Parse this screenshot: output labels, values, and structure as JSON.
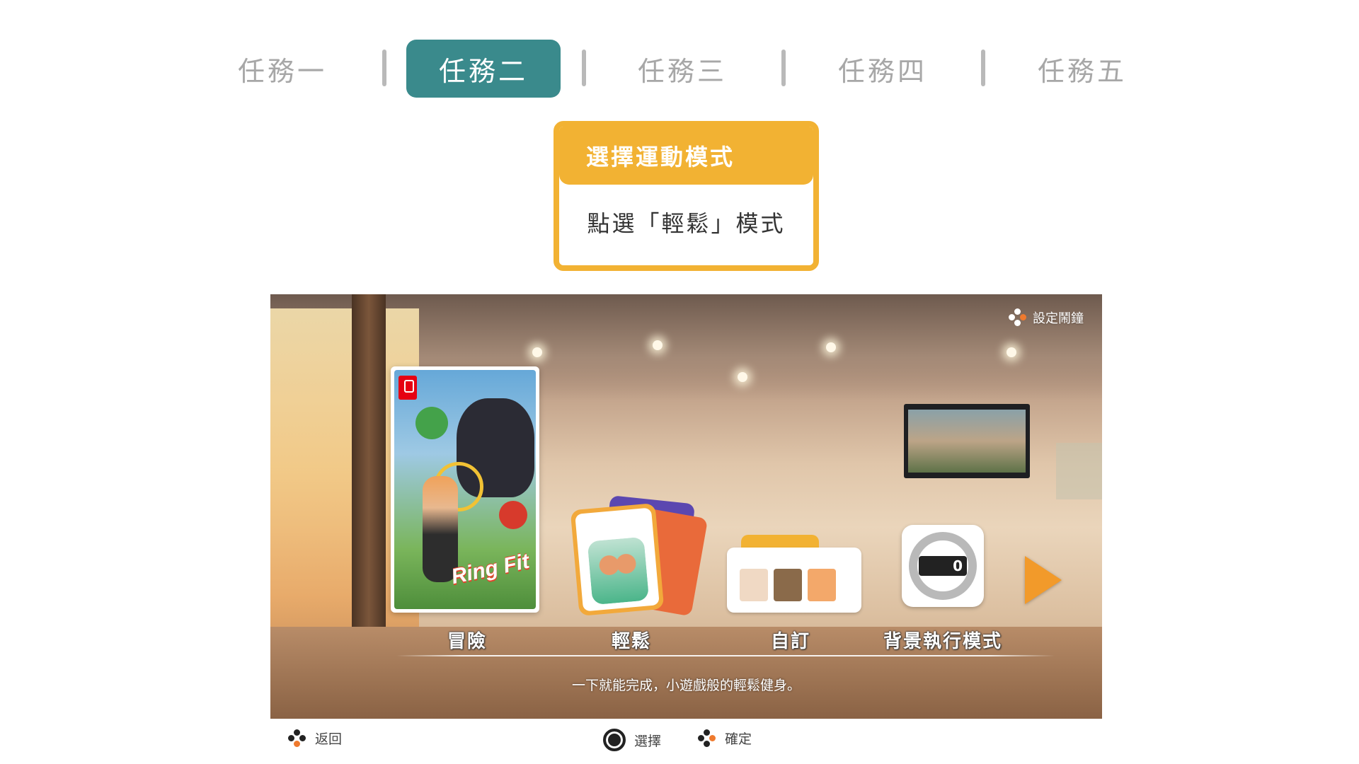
{
  "tabs": [
    {
      "label": "任務一",
      "active": false
    },
    {
      "label": "任務二",
      "active": true
    },
    {
      "label": "任務三",
      "active": false
    },
    {
      "label": "任務四",
      "active": false
    },
    {
      "label": "任務五",
      "active": false
    }
  ],
  "instruction": {
    "title": "選擇運動模式",
    "body": "點選「輕鬆」模式"
  },
  "game": {
    "alarm_label": "設定鬧鐘",
    "boxart_logo": "Ring Fit",
    "modes": [
      {
        "label": "冒險"
      },
      {
        "label": "輕鬆"
      },
      {
        "label": "自訂"
      },
      {
        "label": "背景執行模式"
      }
    ],
    "counter_value": "0",
    "description": "一下就能完成，小遊戲般的輕鬆健身。"
  },
  "controls": {
    "back": "返回",
    "select": "選擇",
    "confirm": "確定"
  },
  "colors": {
    "active_tab": "#3a8a8c",
    "card_accent": "#f2b233",
    "arrow": "#f29a2a"
  }
}
